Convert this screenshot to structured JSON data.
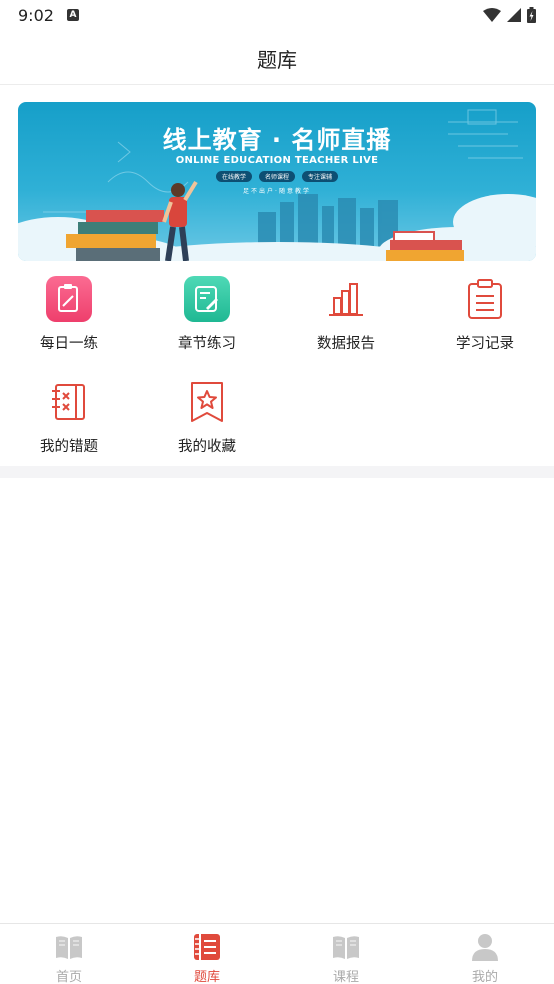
{
  "status_bar": {
    "time": "9:02",
    "notif_letter": "A"
  },
  "header": {
    "title": "题库"
  },
  "banner": {
    "title": "线上教育 · 名师直播",
    "subtitle": "ONLINE EDUCATION TEACHER LIVE",
    "tags": [
      "在线教学",
      "名师课程",
      "专注课辅"
    ],
    "small": "足不出户·随意教学"
  },
  "grid": {
    "items": [
      {
        "label": "每日一练",
        "icon": "daily-practice-icon"
      },
      {
        "label": "章节练习",
        "icon": "chapter-practice-icon"
      },
      {
        "label": "数据报告",
        "icon": "bar-chart-icon"
      },
      {
        "label": "学习记录",
        "icon": "clipboard-icon"
      },
      {
        "label": "我的错题",
        "icon": "wrong-questions-icon"
      },
      {
        "label": "我的收藏",
        "icon": "bookmark-star-icon"
      }
    ]
  },
  "tabbar": {
    "items": [
      {
        "label": "首页",
        "active": false
      },
      {
        "label": "题库",
        "active": true
      },
      {
        "label": "课程",
        "active": false
      },
      {
        "label": "我的",
        "active": false
      }
    ]
  },
  "colors": {
    "accent": "#e04a3c",
    "inactive": "#c8c8c8",
    "pink": "#f0527a",
    "teal": "#2bc4a2",
    "banner": "#169fc9"
  }
}
